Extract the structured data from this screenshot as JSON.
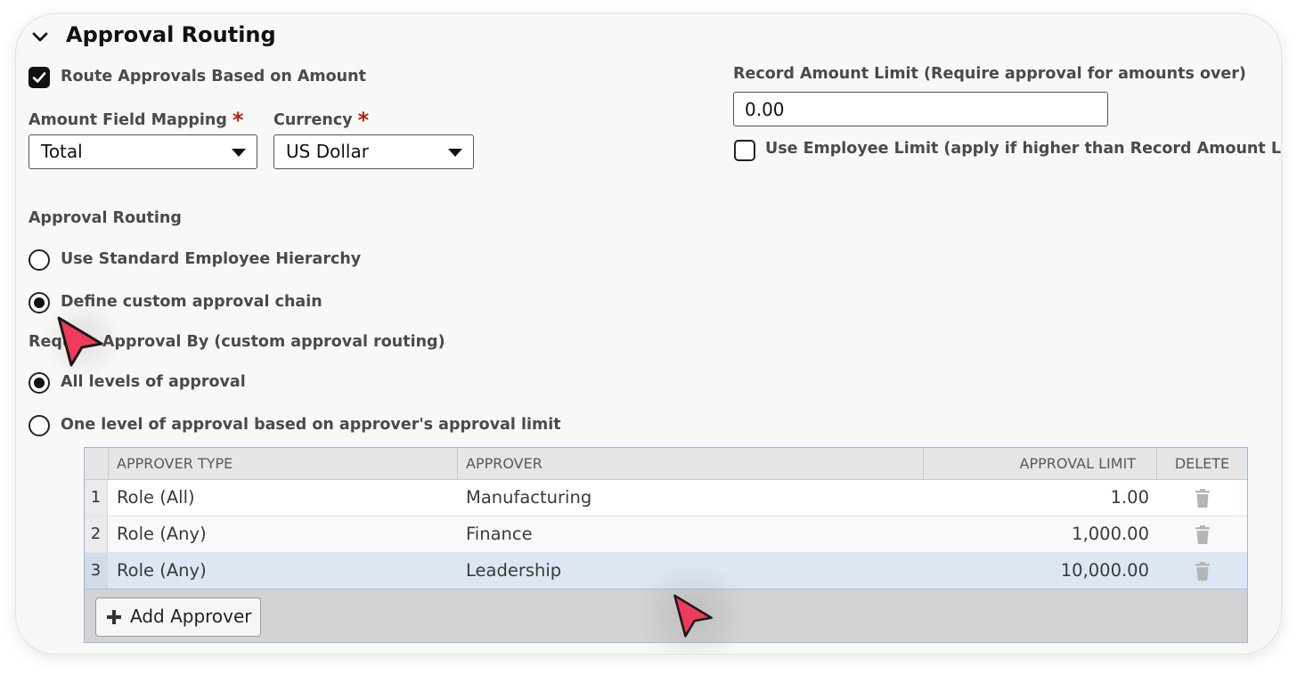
{
  "section": {
    "title": "Approval Routing",
    "icon": "chevron-down-icon"
  },
  "route_by_amount": {
    "label": "Route Approvals Based on Amount",
    "checked": true
  },
  "amount_field": {
    "label": "Amount Field Mapping",
    "required_mark": "*",
    "value": "Total"
  },
  "currency": {
    "label": "Currency",
    "required_mark": "*",
    "value": "US Dollar"
  },
  "record_limit": {
    "label": "Record Amount Limit (Require approval for amounts over)",
    "value": "0.00"
  },
  "employee_limit": {
    "label": "Use Employee Limit (apply if higher than Record Amount Limit)",
    "checked": false
  },
  "routing": {
    "heading": "Approval Routing",
    "options": [
      {
        "label": "Use Standard Employee Hierarchy",
        "selected": false
      },
      {
        "label": "Define custom approval chain",
        "selected": true
      }
    ]
  },
  "require_by": {
    "heading": "Require Approval By (custom approval routing)",
    "options": [
      {
        "label": "All levels of approval",
        "selected": true
      },
      {
        "label": "One level of approval based on approver's approval limit",
        "selected": false
      }
    ]
  },
  "approvers_table": {
    "columns": [
      "APPROVER TYPE",
      "APPROVER",
      "APPROVAL LIMIT",
      "DELETE"
    ],
    "rows": [
      {
        "num": "1",
        "type": "Role (All)",
        "approver": "Manufacturing",
        "limit": "1.00"
      },
      {
        "num": "2",
        "type": "Role (Any)",
        "approver": "Finance",
        "limit": "1,000.00"
      },
      {
        "num": "3",
        "type": "Role (Any)",
        "approver": "Leadership",
        "limit": "10,000.00"
      }
    ],
    "selected_row": 3,
    "add_button": "Add Approver"
  },
  "colors": {
    "accent_required": "#b8200f",
    "cursor": "#f03a5a",
    "selected_row": "#dde7f3"
  }
}
